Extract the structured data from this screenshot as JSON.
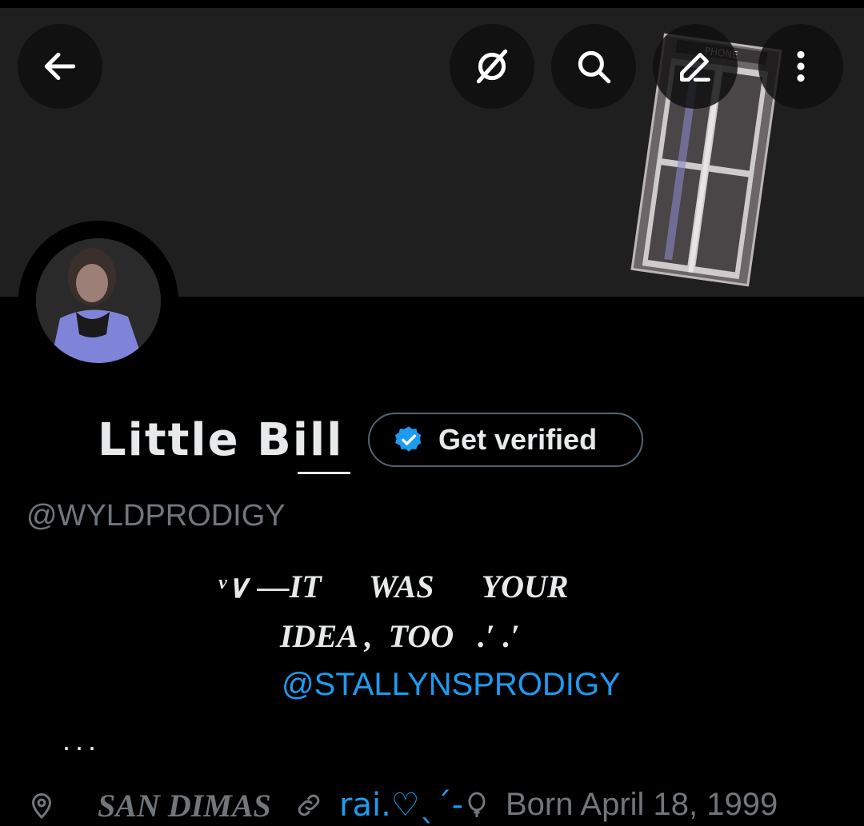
{
  "header": {
    "back_icon": "arrow-left-icon",
    "grok_icon": "grok-icon",
    "search_icon": "search-icon",
    "edit_icon": "edit-icon",
    "more_icon": "more-vertical-icon"
  },
  "profile": {
    "display_name": "Little Bill",
    "handle": "@WYLDPRODIGY",
    "verify_label": "Get verified",
    "verify_badge_color": "#1d9bf0",
    "bio_line1": "ᵛ∨ —IT      WAS      YOUR",
    "bio_line2": "IDEA ,  TOO   .′ .′",
    "bio_mention": "@STALLYNSPRODIGY",
    "bio_ellipsis": "...",
    "location": "SAN DIMAS",
    "link_text": "rai.♡ˎˊ-",
    "birthday": "Born April 18, 1999"
  },
  "colors": {
    "background": "#000000",
    "banner": "#1f1f1f",
    "accent": "#1d9bf0",
    "muted": "#71767b",
    "text": "#e7e9ea"
  }
}
